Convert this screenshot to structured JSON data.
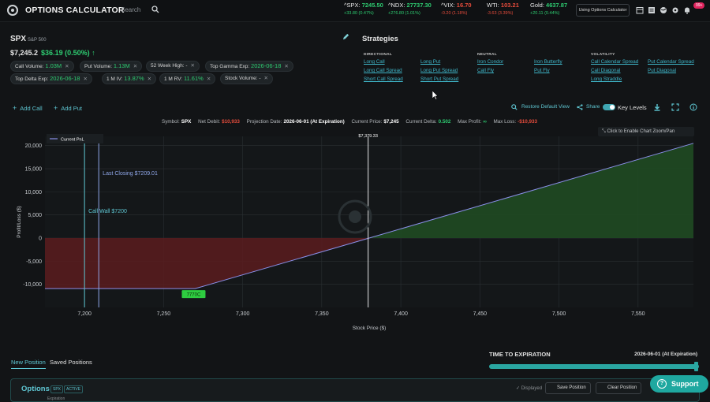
{
  "header": {
    "app_title": "OPTIONS CALCULATOR",
    "search_label": "Search",
    "tickers": [
      {
        "symbol": "^SPX:",
        "price": "7245.50",
        "change": "+33.80 (0.47%)",
        "dir": "pos"
      },
      {
        "symbol": "^NDX:",
        "price": "27737.30",
        "change": "+276.80 (1.01%)",
        "dir": "pos"
      },
      {
        "symbol": "^VIX:",
        "price": "16.70",
        "change": "-0.20 (1.18%)",
        "dir": "neg"
      },
      {
        "symbol": "WTI:",
        "price": "103.21",
        "change": "-3.63 (3.39%)",
        "dir": "neg"
      },
      {
        "symbol": "Gold:",
        "price": "4637.87",
        "change": "+20.11 (0.44%)",
        "dir": "pos"
      }
    ],
    "using_button": "Using Options Calculator",
    "notification_badge": "99+"
  },
  "symbol": {
    "name": "SPX",
    "desc": "S&P 500",
    "price": "$7,245.2",
    "change": "$36.19 (0.50%) ↑"
  },
  "pills": [
    {
      "label": "Call Volume:",
      "value": "1.03M"
    },
    {
      "label": "Put Volume:",
      "value": "1.13M"
    },
    {
      "label": "52 Week High:",
      "value": "-"
    },
    {
      "label": "Top Gamma Exp:",
      "value": "2026-06-18"
    },
    {
      "label": "Top Delta Exp:",
      "value": "2026-06-18"
    },
    {
      "label": "1 M IV:",
      "value": "13.87%"
    },
    {
      "label": "1 M RV:",
      "value": "11.61%"
    },
    {
      "label": "Stock Volume:",
      "value": "-"
    }
  ],
  "strategies": {
    "title": "Strategies",
    "categories": [
      {
        "name": "DIRECTIONAL",
        "col1": [
          "Long Call",
          "Long Call Spread",
          "Short Call Spread"
        ],
        "col2": [
          "Long Put",
          "Long Put Spread",
          "Short Put Spread"
        ]
      },
      {
        "name": "NEUTRAL",
        "col1": [
          "Iron Condor",
          "Call Fly"
        ],
        "col2": [
          "Iron Butterfly",
          "Put Fly"
        ]
      },
      {
        "name": "VOLATILITY",
        "col1": [
          "Call Calendar Spread",
          "Call Diagonal",
          "Long Straddle"
        ],
        "col2": [
          "Put Calendar Spread",
          "Put Diagonal"
        ]
      }
    ]
  },
  "toolbar": {
    "add_call": "Add Call",
    "add_put": "Add Put",
    "restore": "Restore Default View",
    "share": "Share",
    "key_levels": "Key Levels"
  },
  "info": {
    "symbol_label": "Symbol:",
    "symbol": "SPX",
    "net_debit_label": "Net Debit:",
    "net_debit": "$10,933",
    "projection_label": "Projection Date:",
    "projection": "2026-06-01 (At Expiration)",
    "current_price_label": "Current Price:",
    "current_price": "$7,245",
    "current_delta_label": "Current Delta:",
    "current_delta": "0.502",
    "max_profit_label": "Max Profit:",
    "max_profit": "∞",
    "max_loss_label": "Max Loss:",
    "max_loss": "-$10,933"
  },
  "zoom_hint": "Click to Enable Chart Zoom/Pan",
  "chart_data": {
    "type": "area",
    "legend": [
      "Current PnL"
    ],
    "x": [
      7175,
      7270,
      7380,
      7585
    ],
    "y": [
      -10933,
      -10933,
      0,
      20500
    ],
    "xlim": [
      7175,
      7585
    ],
    "ylim": [
      -15000,
      22000
    ],
    "xticks": [
      "7,200",
      "7,250",
      "7,300",
      "7,350",
      "7,400",
      "7,450",
      "7,500",
      "7,550"
    ],
    "xtick_values": [
      7200,
      7250,
      7300,
      7350,
      7400,
      7450,
      7500,
      7550
    ],
    "yticks": [
      "20,000",
      "15,000",
      "10,000",
      "5,000",
      "0",
      "-5,000",
      "-10,000"
    ],
    "ytick_values": [
      20000,
      15000,
      10000,
      5000,
      0,
      -5000,
      -10000
    ],
    "xlabel": "Stock Price ($)",
    "ylabel": "Profit/Loss ($)",
    "vlines": [
      {
        "x": 7200,
        "label": "Call Wall $7200",
        "color": "#5fc7d3"
      },
      {
        "x": 7209.01,
        "label": "Last Closing $7209.01",
        "color": "#8fa6e8"
      },
      {
        "x": 7379.33,
        "label": "$7,379.33",
        "color": "#e6e6e6"
      }
    ],
    "marker_label": "7770C",
    "marker_x": 7270
  },
  "bottom": {
    "tab_new": "New Position",
    "tab_saved": "Saved Positions",
    "time_to_expiration": "TIME TO EXPIRATION",
    "expiration_date": "2026-06-01 (At Expiration)"
  },
  "options_panel": {
    "title": "Options",
    "badge_symbol": "SPX",
    "badge_status": "ACTIVE",
    "expiration_label": "Expiration",
    "displayed": "Displayed",
    "save_position": "Save Position",
    "clear_position": "Clear Position"
  },
  "support_label": "Support"
}
